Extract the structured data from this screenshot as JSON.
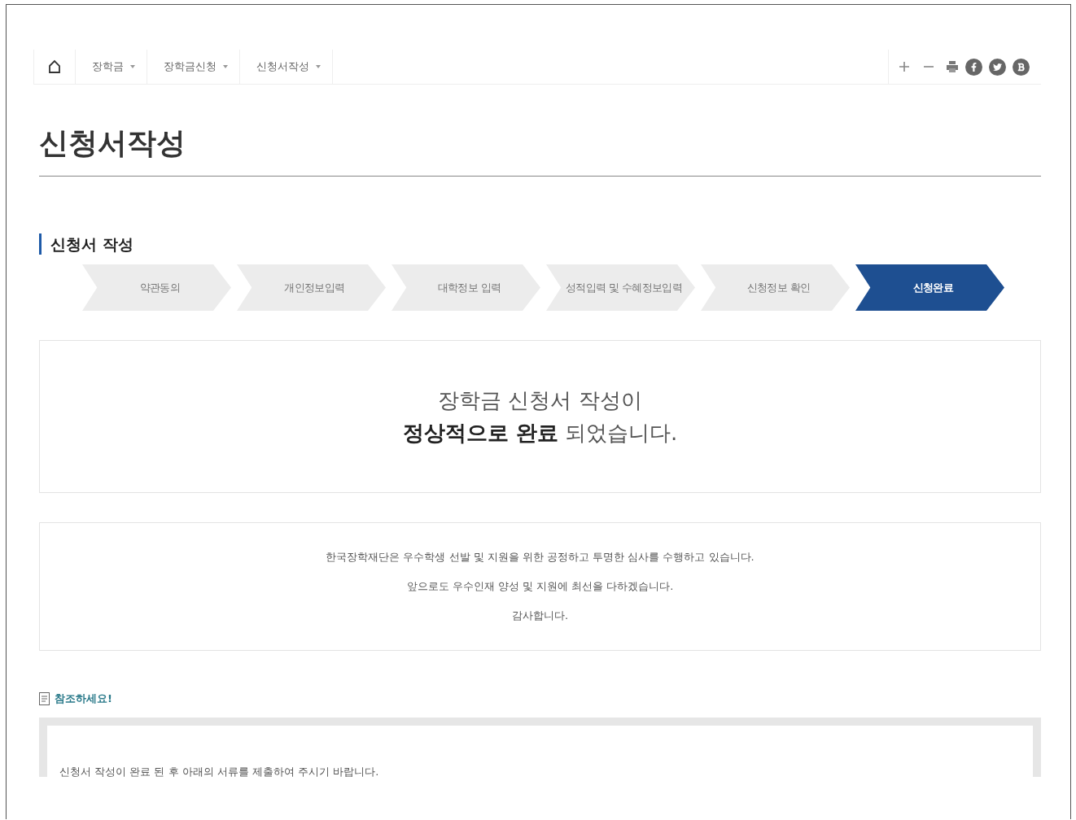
{
  "breadcrumb": {
    "items": [
      {
        "label": "장학금"
      },
      {
        "label": "장학금신청"
      },
      {
        "label": "신청서작성"
      }
    ]
  },
  "page_title": "신청서작성",
  "section_title": "신청서 작성",
  "steps": [
    {
      "label": "약관동의",
      "selected": false
    },
    {
      "label": "개인정보입력",
      "selected": false
    },
    {
      "label": "대학정보 입력",
      "selected": false
    },
    {
      "label": "성적입력 및 수혜정보입력",
      "selected": false
    },
    {
      "label": "신청정보 확인",
      "selected": false
    },
    {
      "label": "신청완료",
      "selected": true
    }
  ],
  "completion_message": [
    "장학금 신청서 작성이",
    "**정상적으로 완료** 되었습니다."
  ],
  "notice_lines": [
    "한국장학재단은 우수학생 선발 및 지원을 위한 공정하고 투명한 심사를 수행하고 있습니다.",
    "앞으로도 우수인재 양성 및 지원에 최선을 다하겠습니다.",
    "감사합니다."
  ],
  "note": {
    "title": "참조하세요!",
    "text": "신청서 작성이 완료 된 후 아래의 서류를 제출하여 주시기 바랍니다."
  }
}
